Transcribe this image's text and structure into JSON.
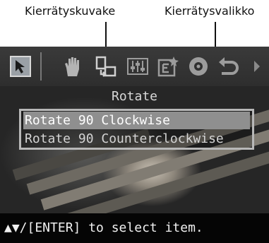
{
  "annotations": {
    "left_label": "Kierrätyskuvake",
    "right_label": "Kierrätysvalikko"
  },
  "toolbar": {
    "icons": [
      {
        "name": "select-arrow-icon",
        "selected": true
      },
      {
        "name": "hand-icon"
      },
      {
        "name": "rotate-icon"
      },
      {
        "name": "adjust-sliders-icon"
      },
      {
        "name": "edit-frame-icon"
      },
      {
        "name": "eye-icon"
      },
      {
        "name": "undo-icon"
      },
      {
        "name": "next-arrow-icon"
      }
    ]
  },
  "menu": {
    "title": "Rotate",
    "items": [
      {
        "label": "Rotate 90 Clockwise",
        "selected": true
      },
      {
        "label": "Rotate 90 Counterclockwise",
        "selected": false
      }
    ]
  },
  "status": {
    "text": "▲▼/[ENTER] to select item."
  },
  "colors": {
    "screen_bg": "#0c0c0c",
    "highlight": "#8f8f8f",
    "toolbar_bg": "#333333",
    "menu_border": "#b8b8b8"
  }
}
